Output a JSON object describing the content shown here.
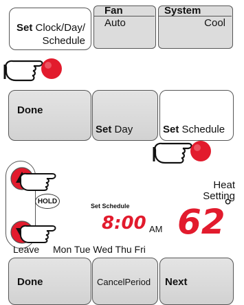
{
  "step1": {
    "set_word": "Set",
    "clock_label": "Clock/Day/",
    "schedule_label": "Schedule",
    "fan_title": "Fan",
    "fan_value": "Auto",
    "system_title": "System",
    "system_value": "Cool"
  },
  "step2": {
    "done_label": "Done",
    "set_word": "Set",
    "set_day_label": "Day",
    "set_schedule_label": "Schedule"
  },
  "display": {
    "hold_label": "HOLD",
    "heat_label": "Heat",
    "setting_label": "Setting",
    "set_schedule_label": "Set Schedule",
    "time": "8:00",
    "ampm": "AM",
    "temperature": "62",
    "degree": "°",
    "period": "Leave",
    "days": "Mon Tue Wed Thu Fri",
    "done_label": "Done",
    "cancel_period_label": "CancelPeriod",
    "next_label": "Next"
  },
  "colors": {
    "accent_red": "#e21b2d",
    "button_grey": "#dcdcdc"
  },
  "icons": [
    "pointing-hand-icon",
    "up-arrow-icon",
    "down-arrow-icon"
  ]
}
